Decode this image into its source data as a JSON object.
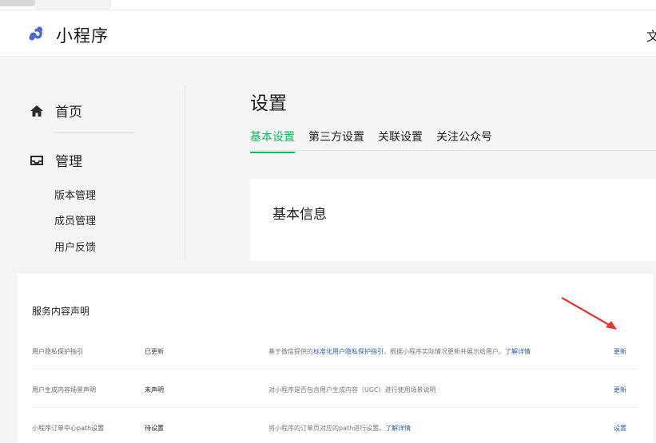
{
  "header": {
    "brand": "小程序",
    "right_text": "文"
  },
  "sidebar": {
    "home_label": "首页",
    "manage_label": "管理",
    "sub_items": [
      "版本管理",
      "成员管理",
      "用户反馈"
    ]
  },
  "main": {
    "title": "设置",
    "tabs": [
      {
        "label": "基本设置",
        "active": true
      },
      {
        "label": "第三方设置",
        "active": false
      },
      {
        "label": "关联设置",
        "active": false
      },
      {
        "label": "关注公众号",
        "active": false
      }
    ],
    "section_title": "基本信息"
  },
  "service": {
    "title": "服务内容声明",
    "rows": [
      {
        "name": "用户隐私保护指引",
        "status": "已更新",
        "desc_pre": "基于微信提供的",
        "desc_link1": "标准化用户隐私保护指引",
        "desc_post": "，根据小程序实际情况更新并展示给用户。",
        "desc_link2": "了解详情",
        "action": "更新"
      },
      {
        "name": "用户生成内容场景声明",
        "status": "未声明",
        "desc_pre": "对小程序是否包含用户生成内容（UGC）进行使用场景说明",
        "desc_link1": "",
        "desc_post": "",
        "desc_link2": "",
        "action": "更新"
      },
      {
        "name": "小程序订单中心path设置",
        "status": "待设置",
        "desc_pre": "将小程序的订单页对应的path进行设置。",
        "desc_link1": "",
        "desc_post": "",
        "desc_link2": "了解详情",
        "action": "设置"
      }
    ]
  },
  "colors": {
    "accent": "#07c160",
    "link": "#2a5db0",
    "annotation": "#e8322b"
  }
}
